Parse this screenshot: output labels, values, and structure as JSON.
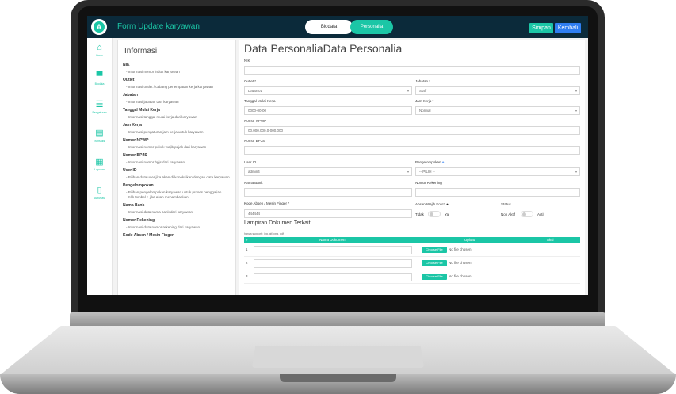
{
  "header": {
    "app_title": "Form Update karyawan",
    "tabs": [
      {
        "label": "Biodata",
        "active": false
      },
      {
        "label": "Personalia",
        "active": true
      }
    ],
    "save_label": "Simpan",
    "back_label": "Kembali"
  },
  "nav": [
    {
      "label": "Home",
      "icon": "home-icon"
    },
    {
      "label": "Biodata",
      "icon": "briefcase-icon"
    },
    {
      "label": "Pengaturan",
      "icon": "sliders-icon"
    },
    {
      "label": "Transaksi",
      "icon": "document-icon"
    },
    {
      "label": "Laporan",
      "icon": "clipboard-icon"
    },
    {
      "label": "Aktivitas",
      "icon": "phone-icon"
    }
  ],
  "info": {
    "title": "Informasi",
    "items": [
      {
        "heading": "NIK",
        "desc": "- Informasi nomor induk karyawan"
      },
      {
        "heading": "Outlet",
        "desc": "- Informasi outlet / cabang penempatan kerja karyawan"
      },
      {
        "heading": "Jabatan",
        "desc": "- Informasi jabatan dari karyawan"
      },
      {
        "heading": "Tanggal Mulai Kerja",
        "desc": "- Informasi tanggal mulai kerja dari karyawan"
      },
      {
        "heading": "Jam Kerja",
        "desc": "- Informasi pengaturan jam kerja untuk karyawan"
      },
      {
        "heading": "Nomor NPWP",
        "desc": "- Informasi nomor pokok wajib pajak dari karyawan"
      },
      {
        "heading": "Nomor BPJS",
        "desc": "- Informasi nomor bpjs dari karyawan"
      },
      {
        "heading": "User ID",
        "desc": "- Pilihan data user jika akan di koneksikan dengan data karyawan"
      },
      {
        "heading": "Pengelompokan",
        "desc": "- Pilihan pengelompokan karyawan untuk proses penggajian\n- Klik tombol + jika akan menambahkan"
      },
      {
        "heading": "Nama Bank",
        "desc": "- Informasi data nama bank dari karyawan"
      },
      {
        "heading": "Nomor Rekening",
        "desc": "- Informasi data nomor rekening dari karyawan"
      },
      {
        "heading": "Kode Absen / Mesin Finger",
        "desc": ""
      }
    ]
  },
  "form": {
    "title": "Data PersonaliaData Personalia",
    "nik_label": "NIK",
    "nik_value": "",
    "outlet_label": "Outlet *",
    "outlet_value": "Dawa-01",
    "jabatan_label": "Jabatan *",
    "jabatan_value": "Staff",
    "tgl_label": "Tanggal Mulai Kerja",
    "tgl_value": "0000-00-00",
    "jam_label": "Jam Kerja *",
    "jam_value": "Normal",
    "npwp_label": "Nomor NPWP",
    "npwp_value": "00.000.000.0-000.000",
    "bpjs_label": "Nomor BPJS",
    "bpjs_value": "",
    "userid_label": "User ID",
    "userid_value": "admin4",
    "kelompok_label": "Pengelompokan",
    "kelompok_add": "+",
    "kelompok_value": "-- PILIH --",
    "bank_label": "Nama Bank",
    "bank_value": "",
    "rek_label": "Nomor Rekening",
    "rek_value": "",
    "absen_label": "Kode Absen / Mesin Finger *",
    "absen_value": "444444",
    "foto_label": "Absen Wajib Foto?",
    "foto_off": "Tidak",
    "foto_on": "Ya",
    "status_label": "Status",
    "status_off": "Non Aktif",
    "status_on": "Aktif"
  },
  "docs": {
    "title": "Lampiran Dokumen Terkait",
    "support_note": "hanya support : jpg, gif, png, pdf",
    "columns": [
      "#",
      "Nama Dokumen",
      "Upload",
      "Aksi"
    ],
    "rows": [
      {
        "num": "1",
        "choose": "Choose File",
        "nofile": "No file chosen"
      },
      {
        "num": "2",
        "choose": "Choose File",
        "nofile": "No file chosen"
      },
      {
        "num": "3",
        "choose": "Choose File",
        "nofile": "No file chosen"
      }
    ]
  },
  "colors": {
    "accent": "#1bc6a6",
    "primary": "#2f7ef1",
    "topbar": "#0b2a3a"
  }
}
